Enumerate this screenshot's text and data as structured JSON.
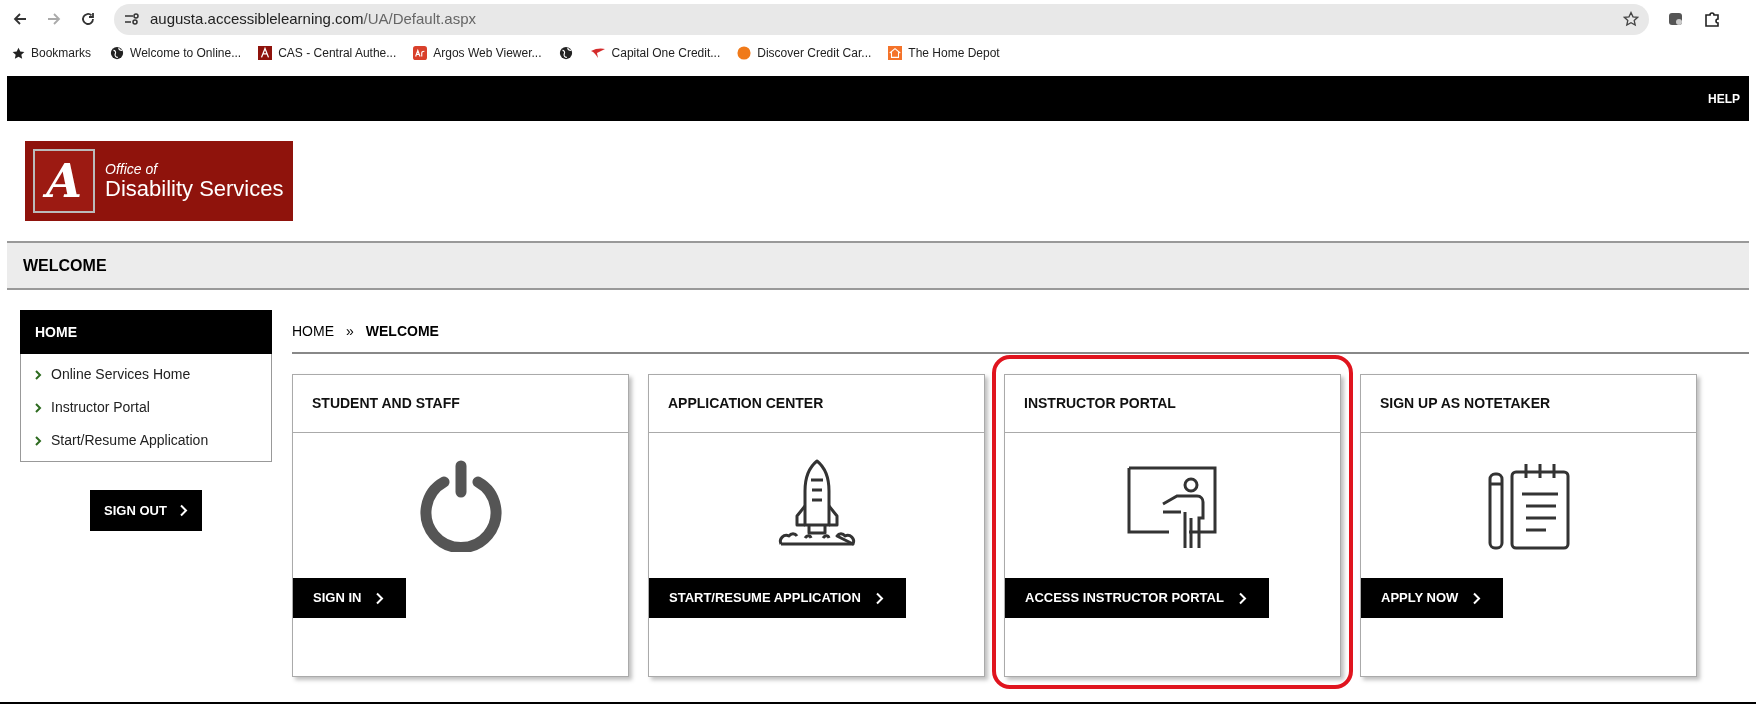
{
  "browser": {
    "url_host": "augusta.accessiblelearning.com",
    "url_path": "/UA/Default.aspx",
    "bookmarks": [
      {
        "kind": "folder",
        "label": "Bookmarks"
      },
      {
        "kind": "link",
        "label": "Welcome to Online..."
      },
      {
        "kind": "link",
        "label": "CAS - Central Authe..."
      },
      {
        "kind": "link",
        "label": "Argos Web Viewer..."
      },
      {
        "kind": "icon_only"
      },
      {
        "kind": "link",
        "label": "Capital One Credit..."
      },
      {
        "kind": "link",
        "label": "Discover Credit Car..."
      },
      {
        "kind": "link",
        "label": "The Home Depot"
      }
    ]
  },
  "top_bar": {
    "help": "HELP"
  },
  "logo": {
    "monogram": "A",
    "line1": "Office of",
    "line2": "Disability Services"
  },
  "page_title": "WELCOME",
  "sidebar": {
    "header": "HOME",
    "items": [
      {
        "label": "Online Services Home"
      },
      {
        "label": "Instructor Portal"
      },
      {
        "label": "Start/Resume Application"
      }
    ],
    "sign_out": "SIGN OUT"
  },
  "breadcrumb": {
    "home": "HOME",
    "separator": "»",
    "current": "WELCOME"
  },
  "cards": [
    {
      "kind": "power",
      "title": "STUDENT AND STAFF",
      "button": "SIGN IN",
      "highlighted": false
    },
    {
      "kind": "rocket",
      "title": "APPLICATION CENTER",
      "button": "START/RESUME APPLICATION",
      "highlighted": false
    },
    {
      "kind": "teacher",
      "title": "INSTRUCTOR PORTAL",
      "button": "ACCESS INSTRUCTOR PORTAL",
      "highlighted": true
    },
    {
      "kind": "notepad",
      "title": "SIGN UP AS NOTETAKER",
      "button": "APPLY NOW",
      "highlighted": false
    }
  ]
}
